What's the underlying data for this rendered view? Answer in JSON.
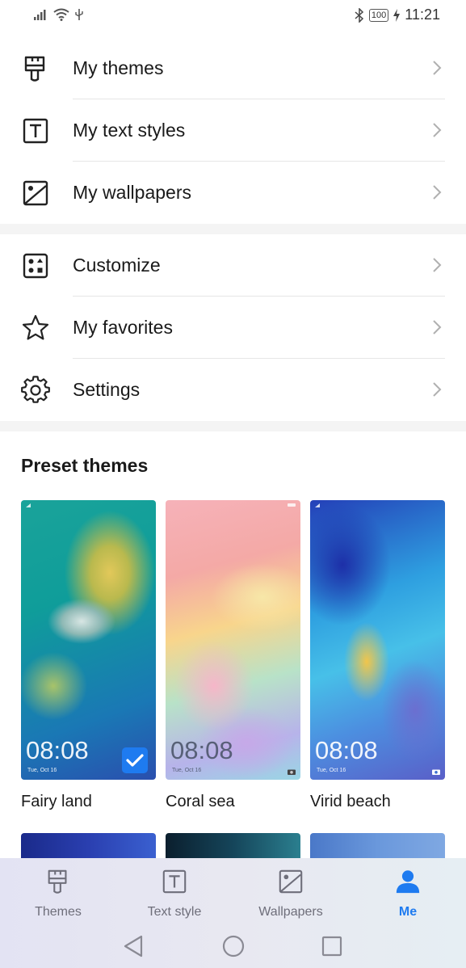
{
  "status_bar": {
    "time": "11:21",
    "battery": "100"
  },
  "menu_group_1": [
    {
      "icon": "brush-icon",
      "label": "My themes"
    },
    {
      "icon": "text-style-icon",
      "label": "My text styles"
    },
    {
      "icon": "wallpaper-icon",
      "label": "My wallpapers"
    }
  ],
  "menu_group_2": [
    {
      "icon": "customize-icon",
      "label": "Customize"
    },
    {
      "icon": "star-icon",
      "label": "My favorites"
    },
    {
      "icon": "gear-icon",
      "label": "Settings"
    }
  ],
  "preset": {
    "title": "Preset themes",
    "themes": [
      {
        "name": "Fairy land",
        "clock": "08:08",
        "date": "Tue, Oct 16",
        "selected": true
      },
      {
        "name": "Coral sea",
        "clock": "08:08",
        "date": "Tue, Oct 16",
        "selected": false
      },
      {
        "name": "Virid beach",
        "clock": "08:08",
        "date": "Tue, Oct 16",
        "selected": false
      }
    ]
  },
  "bottom_nav": {
    "active_color": "#1e7bf0",
    "items": [
      {
        "icon": "brush-icon",
        "label": "Themes",
        "active": false
      },
      {
        "icon": "text-style-icon",
        "label": "Text style",
        "active": false
      },
      {
        "icon": "wallpaper-icon",
        "label": "Wallpapers",
        "active": false
      },
      {
        "icon": "person-icon",
        "label": "Me",
        "active": true
      }
    ]
  },
  "system_nav": [
    "back-icon",
    "home-icon",
    "recents-icon"
  ]
}
